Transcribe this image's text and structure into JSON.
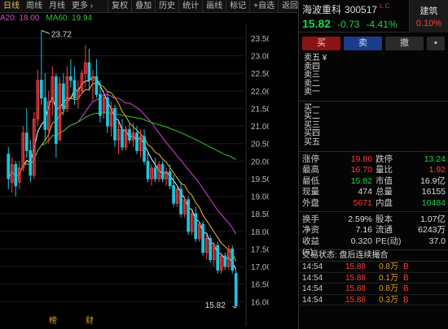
{
  "toolbar": {
    "tabs": [
      "日线",
      "周线",
      "月线",
      "更多 ›"
    ],
    "tools": [
      "复权",
      "叠加",
      "历史",
      "统计",
      "画线",
      "标记"
    ],
    "add_fav": "+自选",
    "back": "返回"
  },
  "ma_legend": {
    "ma20": "A20: 18.00",
    "ma60": "MA60: 19.94",
    "ma20_color": "#e040e0",
    "ma60_color": "#2ec82e"
  },
  "colors": {
    "up": "#ff3c3c",
    "down": "#19c8e0",
    "ma5": "#ffffff",
    "ma10": "#e6c020",
    "ma20": "#e040e0",
    "ma60": "#2ec82e"
  },
  "chart_data": {
    "type": "candlestick",
    "y_ticks": [
      "23.50",
      "23.00",
      "22.50",
      "22.00",
      "21.50",
      "21.00",
      "20.50",
      "20.00",
      "19.50",
      "19.00",
      "18.50",
      "18.00",
      "17.50",
      "17.00",
      "16.50",
      "16.00"
    ],
    "ylim": [
      15.8,
      23.8
    ],
    "high_label": "23.72",
    "low_label": "15.82",
    "markers": [
      "榜",
      "财"
    ],
    "candles": [
      [
        20.2,
        20.4,
        19.2,
        19.5
      ],
      [
        19.4,
        20.1,
        19.1,
        19.9
      ],
      [
        19.9,
        20.0,
        19.0,
        19.3
      ],
      [
        19.4,
        20.0,
        19.2,
        19.8
      ],
      [
        19.8,
        21.0,
        19.7,
        20.8
      ],
      [
        20.8,
        21.5,
        20.1,
        20.3
      ],
      [
        20.3,
        20.6,
        19.4,
        19.6
      ],
      [
        19.6,
        21.4,
        19.5,
        21.2
      ],
      [
        21.2,
        22.6,
        21.0,
        22.3
      ],
      [
        22.3,
        23.72,
        21.6,
        21.8
      ],
      [
        21.8,
        22.5,
        20.6,
        20.9
      ],
      [
        20.9,
        22.0,
        20.5,
        21.7
      ],
      [
        21.7,
        22.7,
        21.3,
        22.4
      ],
      [
        22.4,
        22.5,
        20.1,
        20.5
      ],
      [
        20.6,
        22.4,
        20.6,
        22.2
      ],
      [
        22.2,
        22.5,
        21.3,
        21.5
      ],
      [
        21.5,
        22.7,
        21.4,
        22.4
      ],
      [
        22.4,
        22.9,
        22.1,
        22.3
      ],
      [
        22.3,
        22.7,
        21.6,
        21.8
      ],
      [
        21.8,
        22.3,
        21.5,
        22.0
      ],
      [
        22.0,
        22.6,
        21.9,
        22.5
      ],
      [
        22.5,
        23.3,
        22.1,
        22.8
      ],
      [
        22.8,
        23.2,
        22.0,
        22.3
      ],
      [
        22.3,
        22.6,
        21.7,
        22.4
      ],
      [
        22.4,
        22.9,
        21.8,
        21.9
      ],
      [
        21.9,
        22.3,
        21.1,
        21.3
      ],
      [
        21.4,
        22.0,
        21.2,
        21.8
      ],
      [
        21.8,
        22.0,
        20.8,
        21.0
      ],
      [
        21.0,
        21.7,
        20.7,
        21.5
      ],
      [
        21.5,
        21.6,
        20.4,
        20.6
      ],
      [
        20.6,
        21.1,
        20.2,
        20.9
      ],
      [
        20.9,
        21.2,
        20.3,
        20.4
      ],
      [
        20.4,
        21.0,
        20.3,
        20.9
      ],
      [
        20.9,
        21.1,
        20.5,
        20.6
      ],
      [
        20.6,
        21.1,
        20.4,
        20.8
      ],
      [
        20.8,
        21.0,
        20.2,
        20.3
      ],
      [
        20.3,
        20.9,
        20.1,
        20.7
      ],
      [
        20.7,
        20.9,
        19.9,
        20.0
      ],
      [
        20.0,
        20.3,
        19.4,
        19.5
      ],
      [
        19.5,
        19.9,
        19.3,
        19.8
      ],
      [
        19.8,
        20.1,
        19.4,
        19.5
      ],
      [
        19.5,
        20.0,
        19.4,
        19.9
      ],
      [
        19.9,
        20.0,
        19.4,
        19.5
      ],
      [
        19.5,
        19.8,
        19.3,
        19.7
      ],
      [
        19.7,
        19.9,
        19.2,
        19.3
      ],
      [
        19.3,
        19.6,
        18.7,
        18.8
      ],
      [
        18.8,
        19.3,
        18.7,
        19.2
      ],
      [
        19.2,
        19.4,
        18.4,
        18.5
      ],
      [
        18.5,
        19.0,
        18.4,
        18.9
      ],
      [
        18.9,
        19.0,
        17.9,
        18.0
      ],
      [
        18.0,
        18.6,
        17.9,
        18.5
      ],
      [
        18.5,
        18.7,
        17.7,
        17.8
      ],
      [
        17.8,
        18.3,
        17.7,
        18.2
      ],
      [
        18.2,
        18.3,
        17.3,
        17.4
      ],
      [
        17.4,
        17.9,
        17.2,
        17.8
      ],
      [
        17.8,
        17.9,
        17.1,
        17.2
      ],
      [
        17.2,
        17.7,
        17.0,
        17.6
      ],
      [
        17.6,
        17.7,
        16.8,
        16.9
      ],
      [
        16.9,
        17.4,
        16.8,
        17.3
      ],
      [
        17.3,
        17.4,
        16.9,
        17.0
      ],
      [
        17.0,
        17.6,
        16.9,
        17.5
      ],
      [
        17.5,
        17.6,
        16.8,
        16.9
      ],
      [
        16.8,
        16.9,
        15.82,
        15.88
      ]
    ]
  },
  "stock": {
    "name": "海波重科",
    "code": "300517",
    "flag": "L C",
    "price": "15.82",
    "change": "-0.73",
    "change_pct": "-4.41%",
    "sector": "建筑",
    "sector_chg": "0.10%"
  },
  "trade_buttons": {
    "buy": "买",
    "sell": "卖",
    "cancel": "撤",
    "more": "▪"
  },
  "asks": [
    "卖五 ¥",
    "卖四",
    "卖三",
    "卖二",
    "卖一"
  ],
  "bids": [
    "买一",
    "买二",
    "买三",
    "买四",
    "买五"
  ],
  "stats1": [
    [
      "涨停",
      "19.86",
      "red",
      "跌停",
      "13.24",
      "green"
    ],
    [
      "最高",
      "16.70",
      "red",
      "量比",
      "1.92",
      "red"
    ],
    [
      "最低",
      "15.82",
      "green",
      "市值",
      "16.9亿",
      "white"
    ],
    [
      "现量",
      "474",
      "white",
      "总量",
      "16155",
      "white"
    ],
    [
      "外盘",
      "5671",
      "red",
      "内盘",
      "10484",
      "green"
    ]
  ],
  "stats2": [
    [
      "换手",
      "2.59%",
      "white",
      "股本",
      "1.07亿",
      "white"
    ],
    [
      "净资",
      "7.16",
      "white",
      "流通",
      "6243万",
      "white"
    ],
    [
      "收益(≡)",
      "0.320",
      "white",
      "PE(动)",
      "37.0",
      "white"
    ]
  ],
  "trades_title": "交易状态: 盘后连续撮合",
  "trades": [
    [
      "14:54",
      "15.88",
      "0.8万",
      "B"
    ],
    [
      "14:54",
      "15.88",
      "0.1万",
      "B"
    ],
    [
      "14:54",
      "15.88",
      "0.8万",
      "B"
    ],
    [
      "14:54",
      "15.88",
      "0.3万",
      "B"
    ]
  ]
}
